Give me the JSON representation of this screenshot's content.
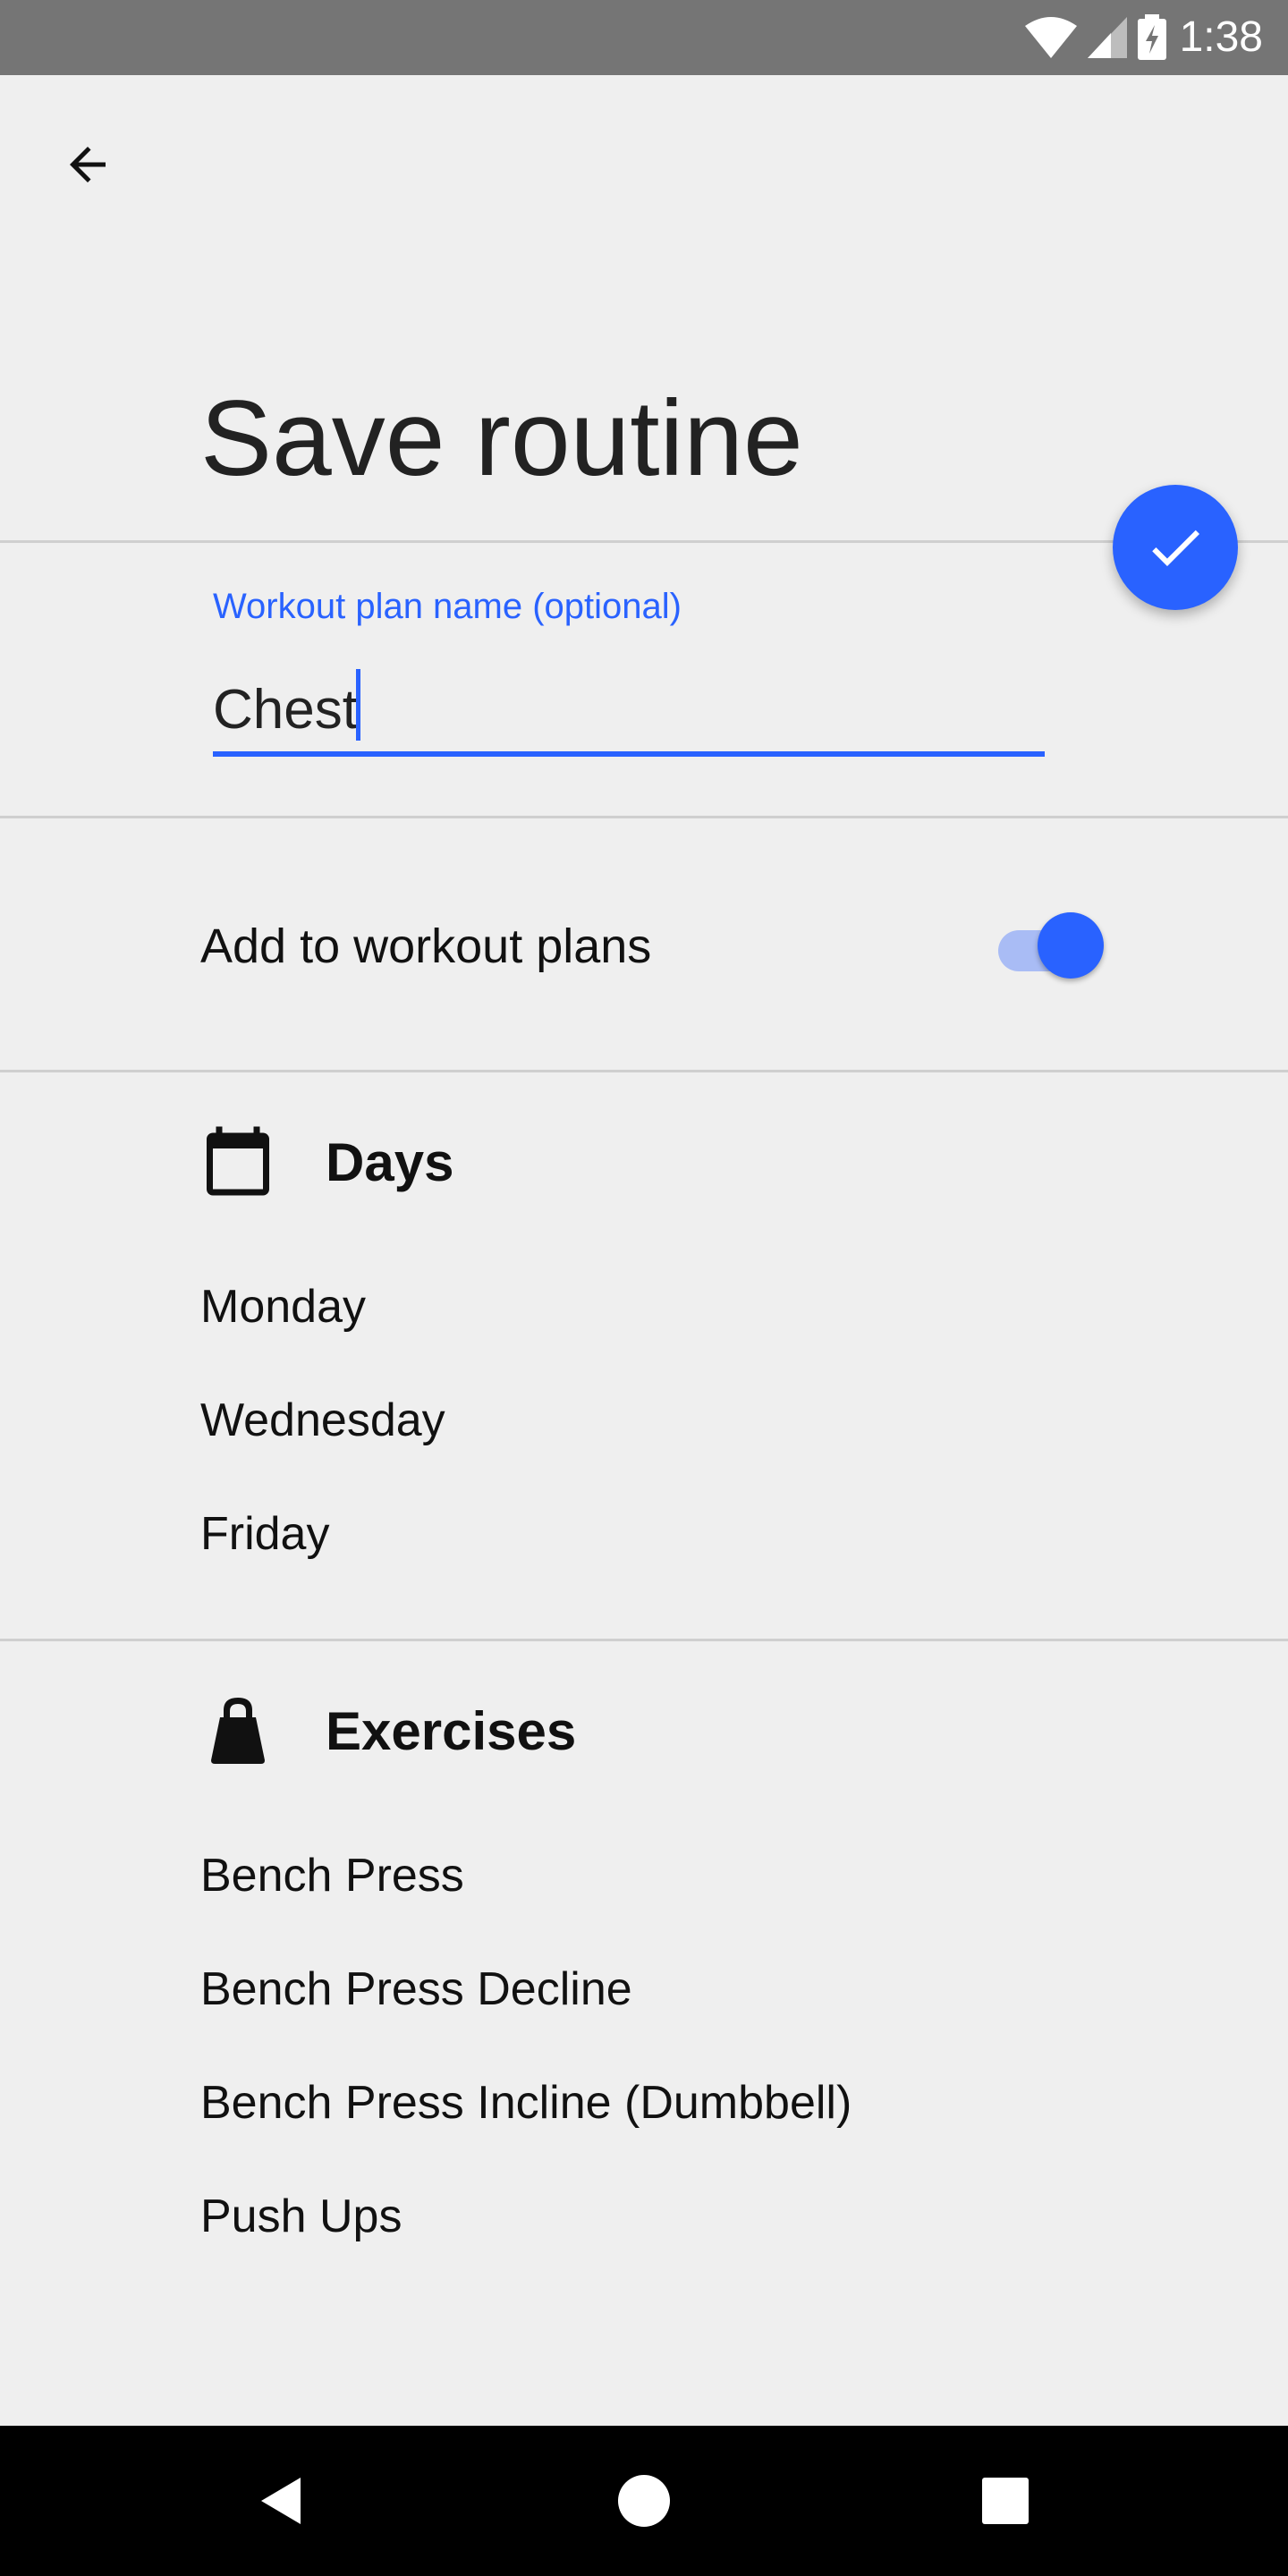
{
  "status_bar": {
    "time": "1:38"
  },
  "header": {
    "title": "Save routine"
  },
  "form": {
    "name_label": "Workout plan name (optional)",
    "name_value": "Chest"
  },
  "toggle_row": {
    "label": "Add to workout plans",
    "enabled": true
  },
  "days": {
    "title": "Days",
    "items": [
      "Monday",
      "Wednesday",
      "Friday"
    ]
  },
  "exercises": {
    "title": "Exercises",
    "items": [
      "Bench Press",
      "Bench Press Decline",
      "Bench Press Incline (Dumbbell)",
      "Push Ups"
    ]
  },
  "icons": {
    "back": "arrow-back-icon",
    "confirm": "check-icon",
    "days": "calendar-icon",
    "exercises": "kettlebell-icon"
  },
  "colors": {
    "accent": "#2962ff",
    "background": "#efefef",
    "status_bar": "#757575",
    "nav_bar": "#000000"
  }
}
